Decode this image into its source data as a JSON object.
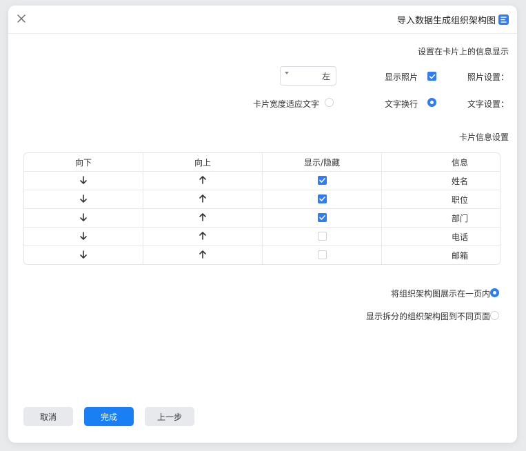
{
  "dialog": {
    "title": "导入数据生成组织架构图",
    "icon": "app-logo-icon",
    "close_icon": "close-icon"
  },
  "display_section": {
    "heading": "设置在卡片上的信息显示",
    "photo_settings_label": "照片设置：",
    "show_photo_label": "显示照片",
    "show_photo_checked": true,
    "photo_position_value": "左",
    "text_settings_label": "文字设置：",
    "wrap_text_label": "文字换行",
    "wrap_text_selected": true,
    "fit_card_width_label": "卡片宽度适应文字",
    "fit_card_width_selected": false
  },
  "card_info": {
    "heading": "卡片信息设置",
    "columns": [
      "信息",
      "显示/隐藏",
      "向上",
      "向下"
    ],
    "rows": [
      {
        "name": "姓名",
        "visible": true
      },
      {
        "name": "职位",
        "visible": true
      },
      {
        "name": "部门",
        "visible": true
      },
      {
        "name": "电话",
        "visible": false
      },
      {
        "name": "邮箱",
        "visible": false
      }
    ],
    "up_icon": "arrow-up-icon",
    "down_icon": "arrow-down-icon"
  },
  "layout_options": {
    "single_page_label": "将组织架构图展示在一页内",
    "single_page_selected": true,
    "split_pages_label": "显示拆分的组织架构图到不同页面",
    "split_pages_selected": false
  },
  "footer": {
    "cancel_label": "取消",
    "finish_label": "完成",
    "previous_label": "上一步"
  },
  "colors": {
    "accent": "#1a7ff5",
    "grey_button": "#e7e9ec",
    "background": "#e9eaec"
  }
}
